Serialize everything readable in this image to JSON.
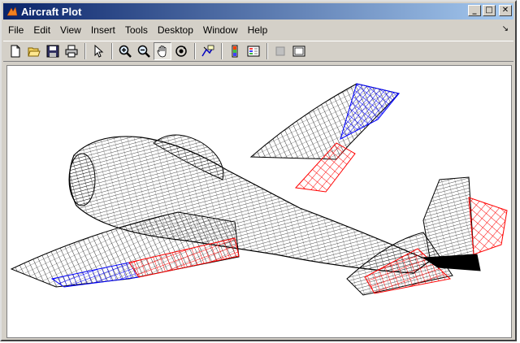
{
  "window": {
    "title": "Aircraft Plot"
  },
  "menu": {
    "items": [
      "File",
      "Edit",
      "View",
      "Insert",
      "Tools",
      "Desktop",
      "Window",
      "Help"
    ]
  },
  "toolbar": {
    "buttons": [
      "new-figure-icon",
      "open-file-icon",
      "save-icon",
      "print-icon",
      "pointer-icon",
      "zoom-in-icon",
      "zoom-out-icon",
      "pan-hand-icon",
      "rotate-3d-icon",
      "data-cursor-icon",
      "colorbar-icon",
      "legend-icon",
      "hide-plot-tools-icon",
      "show-plot-tools-icon"
    ]
  },
  "plot": {
    "subject": "wireframe aircraft",
    "colors": {
      "mesh": "#000000",
      "aileron": "#0000ff",
      "flap": "#ff0000",
      "tail_control": "#ff0000"
    }
  }
}
